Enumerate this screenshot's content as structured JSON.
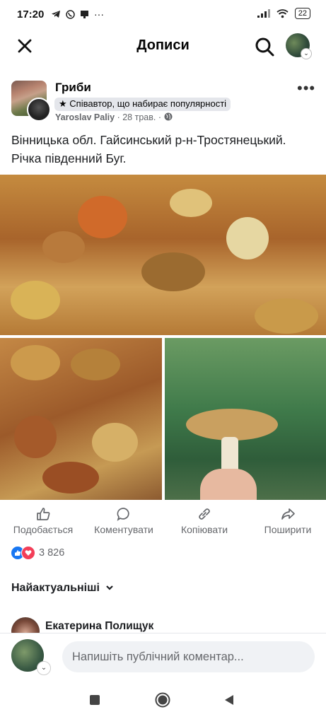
{
  "status": {
    "time": "17:20",
    "battery": "22",
    "more": "···"
  },
  "header": {
    "title": "Дописи"
  },
  "post": {
    "group": "Гриби",
    "badge": "Співавтор, що набирає популярності",
    "author": "Yaroslav Paliy",
    "date": "28 трав.",
    "separator": "·",
    "text": "Вінницька обл. Гайсинський р-н-Тростянецький. Річка південний Буг.",
    "more": "•••"
  },
  "actions": {
    "like": "Подобається",
    "comment": "Коментувати",
    "copy": "Копіювати",
    "share": "Поширити"
  },
  "reactions": {
    "count": "3 826"
  },
  "comments": {
    "sort_label": "Найактуальніші",
    "first_author": "Екатерина Полищук"
  },
  "composer": {
    "placeholder": "Напишіть публічний коментар..."
  },
  "colors": {
    "accent": "#1877f2",
    "love": "#f33e58",
    "muted": "#65676b"
  }
}
